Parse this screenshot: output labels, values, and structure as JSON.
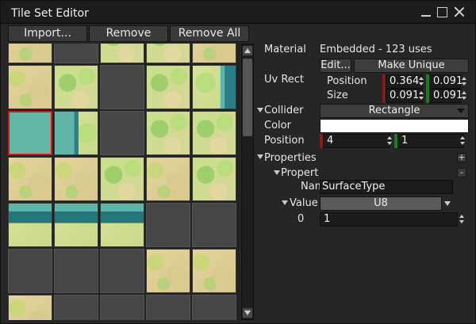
{
  "window": {
    "title": "Tile Set Editor"
  },
  "toolbar": {
    "import_label": "Import...",
    "remove_label": "Remove",
    "remove_all_label": "Remove All"
  },
  "tiles": [
    "sand",
    "empty",
    "grass",
    "grass",
    "sand",
    "sand",
    "grass",
    "empty",
    "grass",
    "water-r",
    "water-selected",
    "water-l",
    "empty",
    "grass",
    "grass",
    "sand",
    "sand",
    "grass",
    "sand",
    "grass",
    "water-t",
    "water-t",
    "water-t",
    "empty",
    "empty",
    "empty",
    "empty",
    "empty",
    "sand",
    "sand",
    "sand",
    "empty",
    "empty",
    "empty",
    "empty"
  ],
  "selected_tile_border": "#e01414",
  "panel": {
    "material_label": "Material",
    "material_value": "Embedded - 123 uses",
    "edit_button": "Edit...",
    "make_unique_button": "Make Unique",
    "uv_rect_label": "Uv Rect",
    "position_label": "Position",
    "size_label": "Size",
    "uv_position_x": "0.364",
    "uv_position_y": "0.091",
    "uv_size_x": "0.091",
    "uv_size_y": "0.091",
    "collider_label": "Collider",
    "collider_value": "Rectangle",
    "color_label": "Color",
    "color_value": "#ffffff",
    "collider_position_label": "Position",
    "collider_position_x": "4",
    "collider_position_y": "1",
    "properties_label": "Properties",
    "property_label": "Propert",
    "name_label": "Name",
    "name_value": "SurfaceType",
    "value_label": "Value",
    "value_type": "U8",
    "index_label": "0",
    "index_value": "1",
    "add_symbol": "+",
    "remove_symbol": "-"
  },
  "axis_colors": {
    "x": "#8b1a1a",
    "y": "#1e7a1e"
  }
}
